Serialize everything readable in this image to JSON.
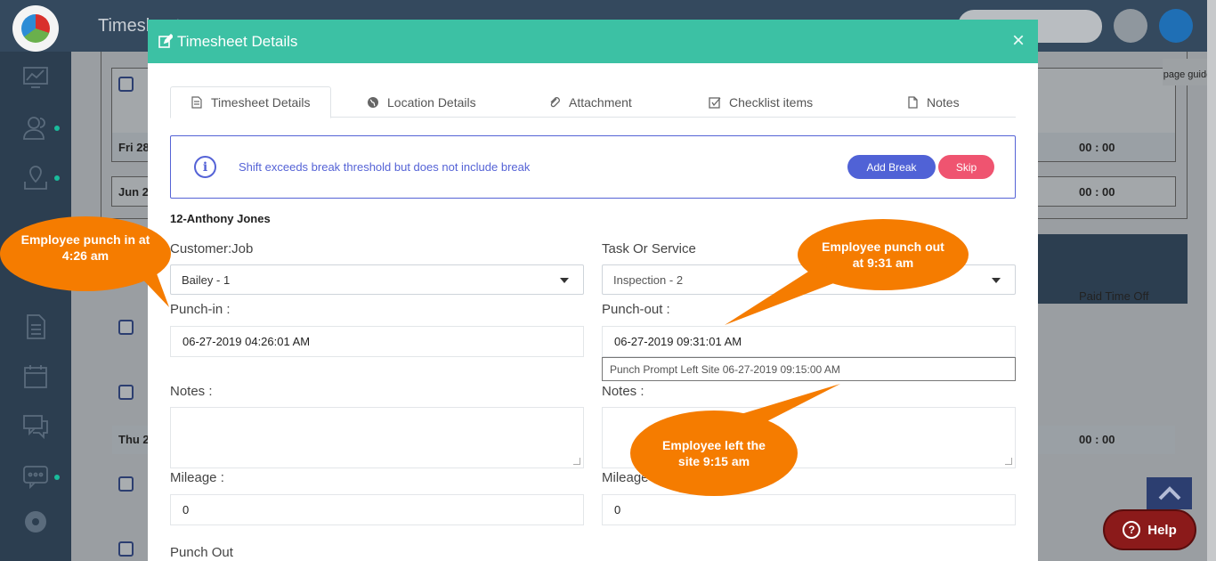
{
  "app": {
    "title": "Timesheets",
    "page_guide": "page guide",
    "help_label": "Help",
    "background_rows": [
      {
        "day": "Fri 28",
        "time": "00 : 00"
      },
      {
        "day": "Jun 2",
        "time": "00 : 00"
      },
      {
        "day": "Thu 2",
        "time": "00 : 00"
      }
    ],
    "paid_time_off": "Paid Time Off"
  },
  "modal": {
    "title": "Timesheet Details",
    "tabs": [
      {
        "label": "Timesheet Details",
        "icon": "document-icon"
      },
      {
        "label": "Location Details",
        "icon": "globe-icon"
      },
      {
        "label": "Attachment",
        "icon": "paperclip-icon"
      },
      {
        "label": "Checklist items",
        "icon": "checkbox-icon"
      },
      {
        "label": "Notes",
        "icon": "file-icon"
      }
    ],
    "alert": {
      "message": "Shift exceeds break threshold but does not include break",
      "add_break": "Add Break",
      "skip": "Skip"
    },
    "employee": "12-Anthony Jones",
    "customer_job": {
      "label": "Customer:Job",
      "value": "Bailey - 1"
    },
    "task_service": {
      "label": "Task Or Service",
      "value": "Inspection - 2"
    },
    "punch_in": {
      "label": "Punch-in :",
      "value": "06-27-2019 04:26:01 AM"
    },
    "punch_out": {
      "label": "Punch-out :",
      "value": "06-27-2019 09:31:01 AM"
    },
    "punch_prompt": "Punch Prompt   Left Site 06-27-2019 09:15:00 AM",
    "notes_left": {
      "label": "Notes :"
    },
    "notes_right": {
      "label": "Notes :"
    },
    "mileage_left": {
      "label": "Mileage :",
      "value": "0"
    },
    "mileage_right": {
      "label": "Mileage :",
      "value": "0"
    },
    "punch_out_section": "Punch Out"
  },
  "callouts": {
    "punch_in": "Employee punch in at 4:26 am",
    "punch_out": "Employee punch out at 9:31 am",
    "left_site": "Employee left the site 9:15 am"
  },
  "colors": {
    "modal_header": "#3cc1a4",
    "alert": "#5563d6",
    "add_break": "#5062d6",
    "skip": "#ef5470",
    "callout": "#f57c00",
    "help": "#8b1a1a"
  }
}
